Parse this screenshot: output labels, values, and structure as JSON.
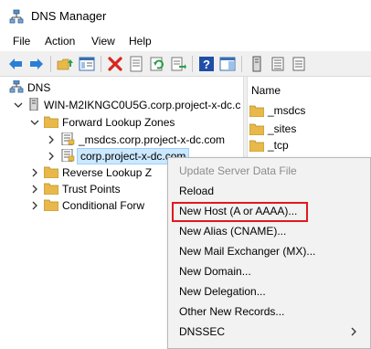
{
  "window": {
    "title": "DNS Manager",
    "icon": "dns-manager-icon"
  },
  "menu": [
    "File",
    "Action",
    "View",
    "Help"
  ],
  "toolbar": {
    "icons": [
      "back-arrow-icon",
      "forward-arrow-icon",
      "up-folder-icon",
      "show-console-tree-icon",
      "delete-icon",
      "properties-icon",
      "refresh-icon",
      "export-list-icon",
      "help-icon",
      "show-action-pane-icon",
      "server-icon",
      "zone-icon",
      "record-icon"
    ]
  },
  "tree": {
    "root": "DNS",
    "server": "WIN-M2IKNGC0U5G.corp.project-x-dc.c",
    "forward_zones": "Forward Lookup Zones",
    "zone_msdcs": "_msdcs.corp.project-x-dc.com",
    "zone_corp": "corp.project-x-dc.com",
    "reverse_zones": "Reverse Lookup Z",
    "trust_points": "Trust Points",
    "conditional": "Conditional Forw"
  },
  "right_pane": {
    "column_header": "Name",
    "items": [
      "_msdcs",
      "_sites",
      "_tcp"
    ]
  },
  "context_menu": {
    "update_server": "Update Server Data File",
    "reload": "Reload",
    "new_host": "New Host (A or AAAA)...",
    "new_alias": "New Alias (CNAME)...",
    "new_mail": "New Mail Exchanger (MX)...",
    "new_domain": "New Domain...",
    "new_delegation": "New Delegation...",
    "other_records": "Other New Records...",
    "dnssec": "DNSSEC"
  },
  "colors": {
    "highlight_border": "#e0181f",
    "selection": "#cce8ff",
    "folder": "#e8b94a"
  }
}
